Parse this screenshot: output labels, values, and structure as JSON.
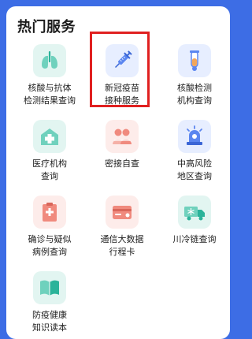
{
  "section": {
    "title": "热门服务"
  },
  "services": [
    {
      "label": "核酸与抗体\n检测结果查询",
      "icon": "lungs-icon",
      "color": "teal"
    },
    {
      "label": "新冠疫苗\n接种服务",
      "icon": "syringe-icon",
      "color": "blue"
    },
    {
      "label": "核酸检测\n机构查询",
      "icon": "test-tube-icon",
      "color": "blue"
    },
    {
      "label": "医疗机构\n查询",
      "icon": "hospital-icon",
      "color": "teal"
    },
    {
      "label": "密接自查",
      "icon": "contacts-icon",
      "color": "pink"
    },
    {
      "label": "中高风险\n地区查询",
      "icon": "siren-icon",
      "color": "blue"
    },
    {
      "label": "确诊与疑似\n病例查询",
      "icon": "clipboard-icon",
      "color": "pink"
    },
    {
      "label": "通信大数据\n行程卡",
      "icon": "travel-card-icon",
      "color": "pink"
    },
    {
      "label": "川冷链查询",
      "icon": "cold-chain-truck-icon",
      "color": "teal"
    },
    {
      "label": "防疫健康\n知识读本",
      "icon": "book-icon",
      "color": "teal"
    }
  ],
  "colors": {
    "page_background": "#3d6de5",
    "highlight_border": "#e02020"
  }
}
